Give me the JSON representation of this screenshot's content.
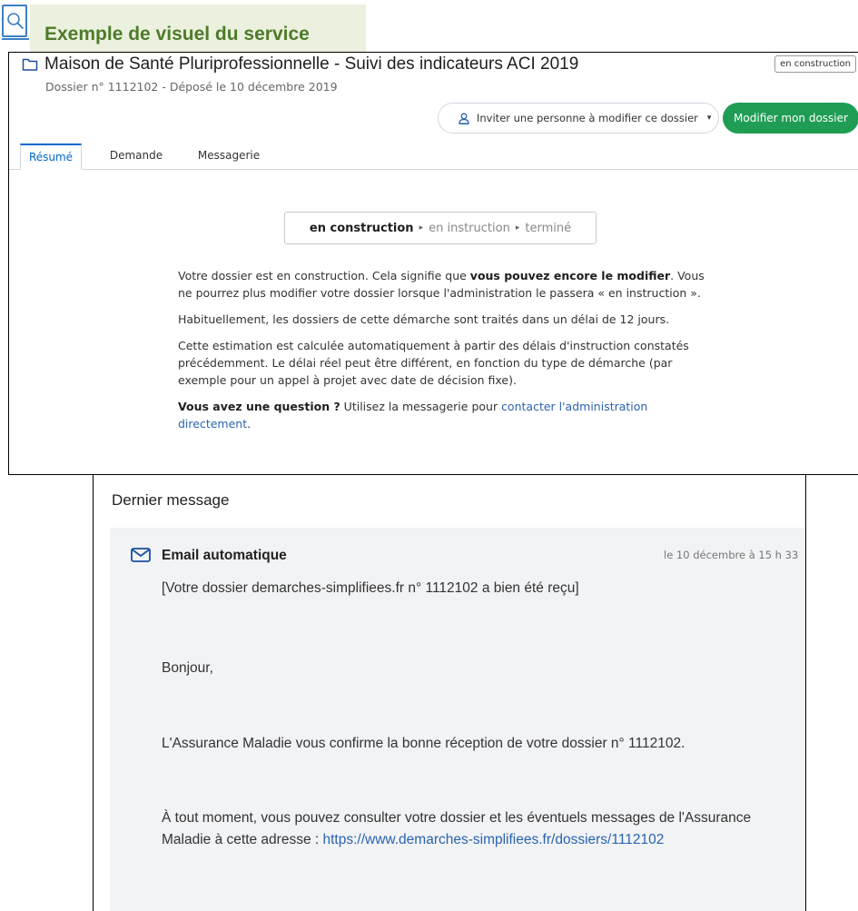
{
  "caption": {
    "title": "Exemple de visuel du service",
    "icon": "search-icon"
  },
  "dossier": {
    "title": "Maison de Santé Pluriprofessionnelle - Suivi des indicateurs ACI 2019",
    "subtitle": "Dossier n° 1112102 - Déposé le 10 décembre 2019",
    "status_badge": "en construction",
    "icon": "folder-icon"
  },
  "actions": {
    "invite_label": "Inviter une personne à modifier ce dossier",
    "invite_caret": "▾",
    "edit_label": "Modifier mon dossier",
    "accent_color": "#1f9d55"
  },
  "tabs": [
    {
      "label": "Résumé",
      "active": true
    },
    {
      "label": "Demande",
      "active": false
    },
    {
      "label": "Messagerie",
      "active": false
    }
  ],
  "status_stepper": {
    "current": "en construction",
    "step2": "en instruction",
    "step3": "terminé",
    "arrow": "▸"
  },
  "summary": {
    "p1_start": "Votre dossier est en construction. Cela signifie que ",
    "p1_bold": "vous pouvez encore le modifier",
    "p1_end": ". Vous ne pourrez plus modifier votre dossier lorsque l'administration le passera « en instruction ».",
    "p2": "Habituellement, les dossiers de cette démarche sont traités dans un délai de 12 jours.",
    "p3": "Cette estimation est calculée automatiquement à partir des délais d'instruction constatés précédemment. Le délai réel peut être différent, en fonction du type de démarche (par exemple pour un appel à projet avec date de décision fixe).",
    "p4_bold": "Vous avez une question ?",
    "p4_text": " Utilisez la messagerie pour ",
    "p4_link": "contacter l'administration directement",
    "p4_end": "."
  },
  "last_message": {
    "section_title": "Dernier message",
    "sender": "Email automatique",
    "date": "le 10 décembre à 15 h 33",
    "subject": "[Votre dossier demarches-simplifiees.fr n° 1112102 a bien été reçu]",
    "greeting": "Bonjour,",
    "body1": "L'Assurance Maladie vous confirme la bonne réception de votre dossier n° 1112102.",
    "body2_text": "À tout moment, vous pouvez consulter votre dossier et les éventuels messages de l'Assurance Maladie à cette adresse : ",
    "body2_link": "https://www.demarches-simplifiees.fr/dossiers/1112102"
  }
}
